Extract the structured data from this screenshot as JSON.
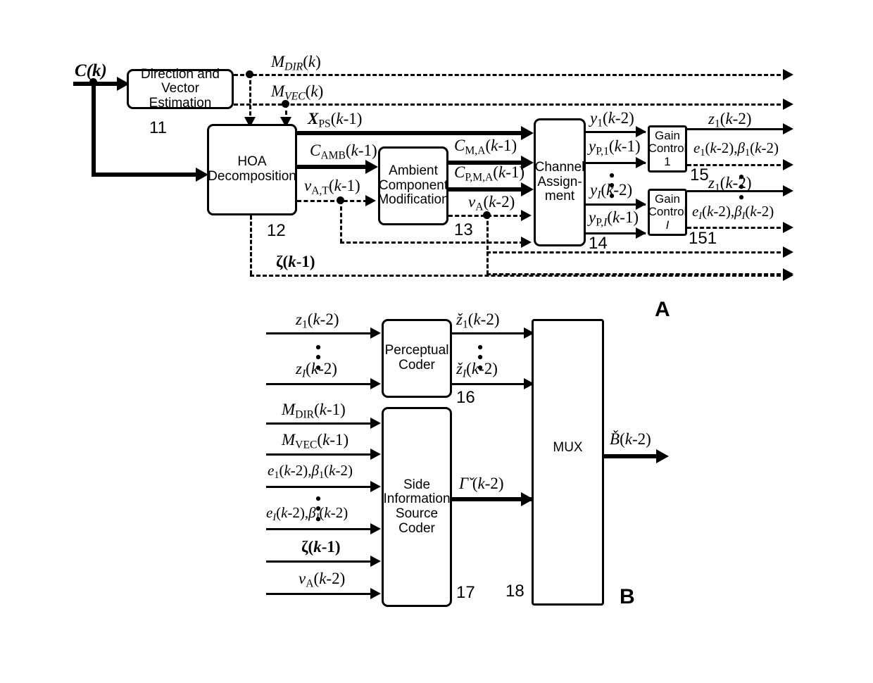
{
  "figure": {
    "panels": [
      {
        "id": "A",
        "label": "A"
      },
      {
        "id": "B",
        "label": "B"
      }
    ]
  },
  "panel_a": {
    "blocks": [
      {
        "name": "direction-vector-estimation",
        "line1": "Direction and",
        "line2": "Vector Estimation",
        "ref": "11"
      },
      {
        "name": "hoa-decomposition",
        "line1": "HOA",
        "line2": "Decomposition",
        "ref": "12"
      },
      {
        "name": "ambient-component-modification",
        "line1": "Ambient",
        "line2": "Component",
        "line3": "Modification",
        "ref": "13"
      },
      {
        "name": "channel-assignment",
        "line1": "Channel",
        "line2": "Assign-",
        "line3": "ment",
        "ref": "14"
      },
      {
        "name": "gain-control-1",
        "line1": "Gain",
        "line2": "Control",
        "line3": "1",
        "ref": "15"
      },
      {
        "name": "gain-control-i",
        "line1": "Gain",
        "line2": "Control",
        "line3": "I",
        "ref": "151"
      }
    ],
    "signals": {
      "input": "C(k)",
      "m_dir": "MDIR(k)",
      "m_vec": "MVEC(k)",
      "x_ps": "XPS(k-1)",
      "c_amb": "CAMB(k-1)",
      "v_at": "vA,T(k-1)",
      "c_ma": "CM,A(k-1)",
      "c_pma": "CP,M,A(k-1)",
      "v_a": "vA(k-2)",
      "y1": "y1(k-2)",
      "yp1": "yP,1(k-1)",
      "yi": "yI(k-2)",
      "ypi": "yP,I(k-1)",
      "z1_top": "z1(k-2)",
      "e1b1": "e1(k-2),β1(k-2)",
      "z1_bottom": "z1(k-2)",
      "eibi": "eI(k-2),βI(k-2)",
      "zeta": "ζ(k-1)"
    }
  },
  "panel_b": {
    "blocks": [
      {
        "name": "perceptual-coder",
        "line1": "Perceptual",
        "line2": "Coder",
        "ref": "16"
      },
      {
        "name": "side-information-source-coder",
        "line1": "Side",
        "line2": "Information",
        "line3": "Source",
        "line4": "Coder",
        "ref": "17"
      },
      {
        "name": "mux",
        "line1": "MUX",
        "ref": "18"
      }
    ],
    "signals": {
      "z1_in": "z1(k-2)",
      "zi_in": "zI(k-2)",
      "z1_out": "ž1(k-2)",
      "zi_out": "žI(k-2)",
      "m_dir": "MDIR(k-1)",
      "m_vec": "MVEC(k-1)",
      "e1b1": "e1(k-2),β1(k-2)",
      "eibi": "eI(k-2),βI(k-2)",
      "zeta": "ζ(k-1)",
      "v_a": "vA(k-2)",
      "gamma_out": "Γ̌(k-2)",
      "b_out": "B̌(k-2)"
    }
  }
}
